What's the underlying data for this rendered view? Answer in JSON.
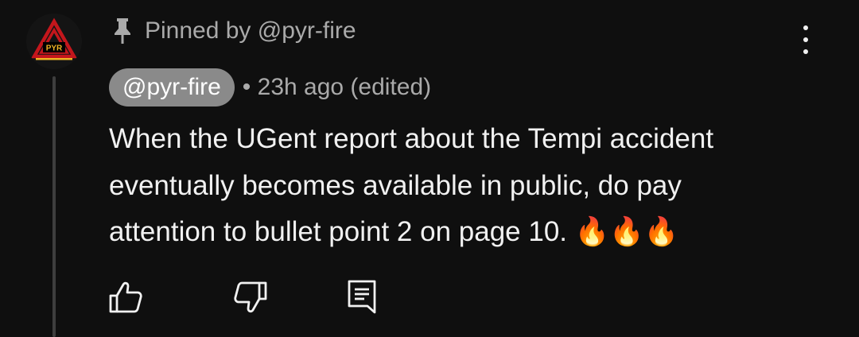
{
  "comment": {
    "pinned_label": "Pinned by @pyr-fire",
    "author": "@pyr-fire",
    "meta": "• 23h ago (edited)",
    "text_lines": [
      "When the UGent report about the Tempi accident",
      "eventually becomes available in public, do pay",
      "attention to bullet point 2 on page 10."
    ],
    "emojis": "🔥🔥🔥",
    "avatar_text": "PYR"
  },
  "icons": {
    "pin": "pin-icon",
    "menu": "more-vertical-icon",
    "like": "thumbs-up-icon",
    "dislike": "thumbs-down-icon",
    "reply": "reply-comment-icon"
  },
  "colors": {
    "background": "#0f0f0f",
    "text": "#f1f1f1",
    "muted": "#aaaaaa",
    "author_chip": "#8a8a8a",
    "avatar_red": "#c4161c",
    "avatar_gold": "#f0b424"
  }
}
